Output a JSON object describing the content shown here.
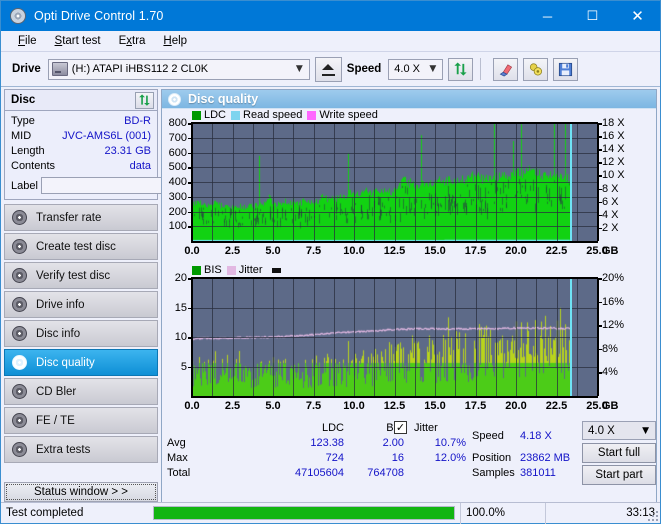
{
  "window": {
    "title": "Opti Drive Control 1.70",
    "icon": "disc-icon",
    "minimize": "─",
    "maximize": "☐",
    "close": "✕"
  },
  "menubar": {
    "items": [
      {
        "label": "File",
        "accel": "F"
      },
      {
        "label": "Start test",
        "accel": "S"
      },
      {
        "label": "Extra",
        "accel": "x"
      },
      {
        "label": "Help",
        "accel": "H"
      }
    ]
  },
  "toolbar": {
    "drive_label": "Drive",
    "drive_value": "(H:)  ATAPI iHBS112  2 CL0K",
    "eject_title": "eject-button",
    "speed_label": "Speed",
    "speed_value": "4.0 X",
    "refresh_icon": "refresh-icon",
    "erase_icon": "erase-icon",
    "bookmark_icon": "bookmark-icon",
    "save_icon": "save-icon"
  },
  "sidebar": {
    "disc_panel": {
      "title": "Disc",
      "refresh_icon": "refresh-icon",
      "rows": [
        {
          "key": "Type",
          "value": "BD-R"
        },
        {
          "key": "MID",
          "value": "JVC-AMS6L (001)"
        },
        {
          "key": "Length",
          "value": "23.31 GB"
        },
        {
          "key": "Contents",
          "value": "data"
        }
      ],
      "label_key": "Label",
      "label_value": "",
      "label_placeholder": ""
    },
    "nav": [
      {
        "label": "Transfer rate",
        "active": false
      },
      {
        "label": "Create test disc",
        "active": false
      },
      {
        "label": "Verify test disc",
        "active": false
      },
      {
        "label": "Drive info",
        "active": false
      },
      {
        "label": "Disc info",
        "active": false
      },
      {
        "label": "Disc quality",
        "active": true
      },
      {
        "label": "CD Bler",
        "active": false
      },
      {
        "label": "FE / TE",
        "active": false
      },
      {
        "label": "Extra tests",
        "active": false
      }
    ],
    "status_window_button": "Status window > >"
  },
  "main": {
    "header_title": "Disc quality",
    "header_icon": "disc-quality-icon"
  },
  "stats": {
    "col_ldc": "LDC",
    "col_bis": "BIS",
    "row_avg": "Avg",
    "row_max": "Max",
    "row_total": "Total",
    "ldc_avg": "123.38",
    "ldc_max": "724",
    "ldc_total": "47105604",
    "bis_avg": "2.00",
    "bis_max": "16",
    "bis_total": "764708",
    "jitter_label": "Jitter",
    "jitter_checked": "✓",
    "jitter_avg": "10.7%",
    "jitter_max": "12.0%",
    "speed_label": "Speed",
    "speed_value": "4.18 X",
    "position_label": "Position",
    "position_value": "23862 MB",
    "samples_label": "Samples",
    "samples_value": "381011",
    "speed_select": "4.0 X",
    "start_full": "Start full",
    "start_part": "Start part"
  },
  "statusbar": {
    "text": "Test completed",
    "percent": "100.0%",
    "progress": 100,
    "elapsed": "33:13"
  },
  "colors": {
    "accent": "#0078d7",
    "plot_bg": "#5d6a88",
    "ldc_green": "#12d212",
    "bis_green": "#4ccc18",
    "jitter_pink": "#e2b8e2",
    "read_speed_cyan": "#6fe3f5",
    "write_speed_magenta": "#ff66ff",
    "value_blue": "#1414c8",
    "progress_green": "#12b512"
  },
  "chart_data": [
    {
      "type": "area",
      "name": "disc-quality-ldc-chart",
      "title": "",
      "xlabel": "GB",
      "ylabel": "",
      "xlim": [
        0,
        25
      ],
      "ylim": [
        0,
        800
      ],
      "y2lim": [
        0,
        18
      ],
      "xticks": [
        "0.0",
        "2.5",
        "5.0",
        "7.5",
        "10.0",
        "12.5",
        "15.0",
        "17.5",
        "20.0",
        "22.5",
        "25.0"
      ],
      "yticks": [
        100,
        200,
        300,
        400,
        500,
        600,
        700,
        800
      ],
      "y2ticks": [
        "2 X",
        "4 X",
        "6 X",
        "8 X",
        "10 X",
        "12 X",
        "14 X",
        "16 X",
        "18 X"
      ],
      "grid": true,
      "legend_position": "top-left",
      "legend": [
        {
          "name": "LDC",
          "color": "#009900"
        },
        {
          "name": "Read speed",
          "color": "#7fd4ef"
        },
        {
          "name": "Write speed",
          "color": "#ff66ff"
        }
      ],
      "series": [
        {
          "name": "LDC",
          "type": "area",
          "color": "#12d212",
          "x": [
            0.0,
            0.25,
            0.5,
            0.75,
            1.0,
            1.25,
            1.5,
            1.75,
            2.0,
            2.25,
            2.5,
            2.75,
            3.0,
            3.25,
            3.5,
            3.75,
            4.0,
            4.25,
            4.5,
            4.75,
            5.0,
            5.25,
            5.5,
            5.75,
            6.0,
            6.25,
            6.5,
            6.75,
            7.0,
            7.25,
            7.5,
            7.75,
            8.0,
            8.25,
            8.5,
            8.75,
            9.0,
            9.25,
            9.5,
            9.75,
            10.0,
            10.25,
            10.5,
            10.75,
            11.0,
            11.25,
            11.5,
            11.75,
            12.0,
            12.25,
            12.5,
            12.75,
            13.0,
            13.25,
            13.5,
            13.75,
            14.0,
            14.25,
            14.5,
            14.75,
            15.0,
            15.25,
            15.5,
            15.75,
            16.0,
            16.25,
            16.5,
            16.75,
            17.0,
            17.25,
            17.5,
            17.75,
            18.0,
            18.25,
            18.5,
            18.75,
            19.0,
            19.25,
            19.5,
            19.75,
            20.0,
            20.25,
            20.5,
            20.75,
            21.0,
            21.25,
            21.5,
            21.75,
            22.0,
            22.25,
            22.5,
            23.0,
            23.3
          ],
          "values": [
            255,
            248,
            252,
            250,
            245,
            248,
            250,
            238,
            235,
            240,
            228,
            232,
            235,
            230,
            232,
            228,
            238,
            242,
            246,
            300,
            250,
            248,
            260,
            262,
            258,
            262,
            255,
            258,
            270,
            262,
            258,
            268,
            300,
            280,
            275,
            278,
            290,
            300,
            295,
            320,
            310,
            305,
            315,
            330,
            325,
            320,
            330,
            340,
            335,
            330,
            340,
            350,
            420,
            380,
            400,
            360,
            370,
            372,
            380,
            375,
            382,
            400,
            395,
            405,
            390,
            410,
            400,
            420,
            415,
            430,
            420,
            425,
            415,
            420,
            430,
            435,
            425,
            445,
            440,
            450,
            445,
            460,
            455,
            465,
            470,
            465,
            460,
            440,
            445,
            450,
            440,
            430,
            420
          ]
        },
        {
          "name": "Read speed",
          "type": "line",
          "color": "#6fe3f5",
          "x": [
            0.0,
            1.0,
            2.0,
            3.0,
            4.0,
            5.0,
            6.0,
            7.0,
            8.0,
            9.0,
            10.0,
            11.0,
            12.0,
            13.0,
            14.0,
            15.0,
            16.0,
            17.0,
            18.0,
            19.0,
            20.0,
            21.0,
            22.0,
            23.3
          ],
          "values": [
            1.9,
            2.0,
            2.1,
            2.2,
            2.3,
            2.5,
            2.6,
            2.7,
            2.8,
            2.9,
            3.0,
            3.1,
            3.2,
            3.3,
            3.4,
            3.5,
            3.6,
            3.7,
            3.8,
            3.9,
            4.0,
            4.1,
            4.15,
            4.2
          ]
        }
      ],
      "marker_line_x": 23.35,
      "marker_line_color": "#6fe3f5"
    },
    {
      "type": "area",
      "name": "disc-quality-bis-chart",
      "title": "",
      "xlabel": "GB",
      "ylabel": "",
      "xlim": [
        0,
        25
      ],
      "ylim": [
        0,
        20
      ],
      "y2lim": [
        0,
        20
      ],
      "xticks": [
        "0.0",
        "2.5",
        "5.0",
        "7.5",
        "10.0",
        "12.5",
        "15.0",
        "17.5",
        "20.0",
        "22.5",
        "25.0"
      ],
      "yticks": [
        5,
        10,
        15,
        20
      ],
      "y2ticks": [
        "4%",
        "8%",
        "12%",
        "16%",
        "20%"
      ],
      "grid": true,
      "legend_position": "top-left",
      "legend": [
        {
          "name": "BIS",
          "color": "#009900"
        },
        {
          "name": "Jitter",
          "color": "#e2b8e2"
        }
      ],
      "series": [
        {
          "name": "BIS",
          "type": "area",
          "color": "#4ccc18",
          "x": [
            0.0,
            0.5,
            1.0,
            1.5,
            2.0,
            2.5,
            3.0,
            3.5,
            4.0,
            4.5,
            5.0,
            5.5,
            6.0,
            6.5,
            7.0,
            7.5,
            8.0,
            8.5,
            9.0,
            9.5,
            10.0,
            10.5,
            11.0,
            11.5,
            12.0,
            12.5,
            13.0,
            13.5,
            14.0,
            14.5,
            15.0,
            15.5,
            16.0,
            16.5,
            17.0,
            17.5,
            18.0,
            18.5,
            19.0,
            19.5,
            20.0,
            20.5,
            21.0,
            21.5,
            22.0,
            22.5,
            23.0,
            23.3
          ],
          "values": [
            5.2,
            5.0,
            5.1,
            5.0,
            5.2,
            5.0,
            5.1,
            5.0,
            5.2,
            5.1,
            5.3,
            5.2,
            5.4,
            5.3,
            5.5,
            5.6,
            5.8,
            5.9,
            6.0,
            6.2,
            6.3,
            6.5,
            6.6,
            6.8,
            7.0,
            7.2,
            7.5,
            7.7,
            8.0,
            8.2,
            8.4,
            8.6,
            8.8,
            9.0,
            9.2,
            9.4,
            9.6,
            9.8,
            10.0,
            10.2,
            10.4,
            10.6,
            10.8,
            11.0,
            10.8,
            10.6,
            10.2,
            9.8
          ]
        },
        {
          "name": "Jitter",
          "type": "line",
          "color": "#e2b8e2",
          "x": [
            0.0,
            1.0,
            2.0,
            3.0,
            4.0,
            5.0,
            6.0,
            7.0,
            8.0,
            9.0,
            10.0,
            11.0,
            12.0,
            13.0,
            14.0,
            15.0,
            16.0,
            17.0,
            18.0,
            19.0,
            20.0,
            21.0,
            22.0,
            23.3
          ],
          "values": [
            9.7,
            9.8,
            9.8,
            9.9,
            9.9,
            10.0,
            10.1,
            10.3,
            10.5,
            10.7,
            10.9,
            11.0,
            11.2,
            11.3,
            11.4,
            11.4,
            11.4,
            11.4,
            11.4,
            11.4,
            11.5,
            11.5,
            11.5,
            11.4
          ]
        }
      ],
      "marker_line_x": 23.35,
      "marker_line_color": "#6fe3f5"
    }
  ]
}
